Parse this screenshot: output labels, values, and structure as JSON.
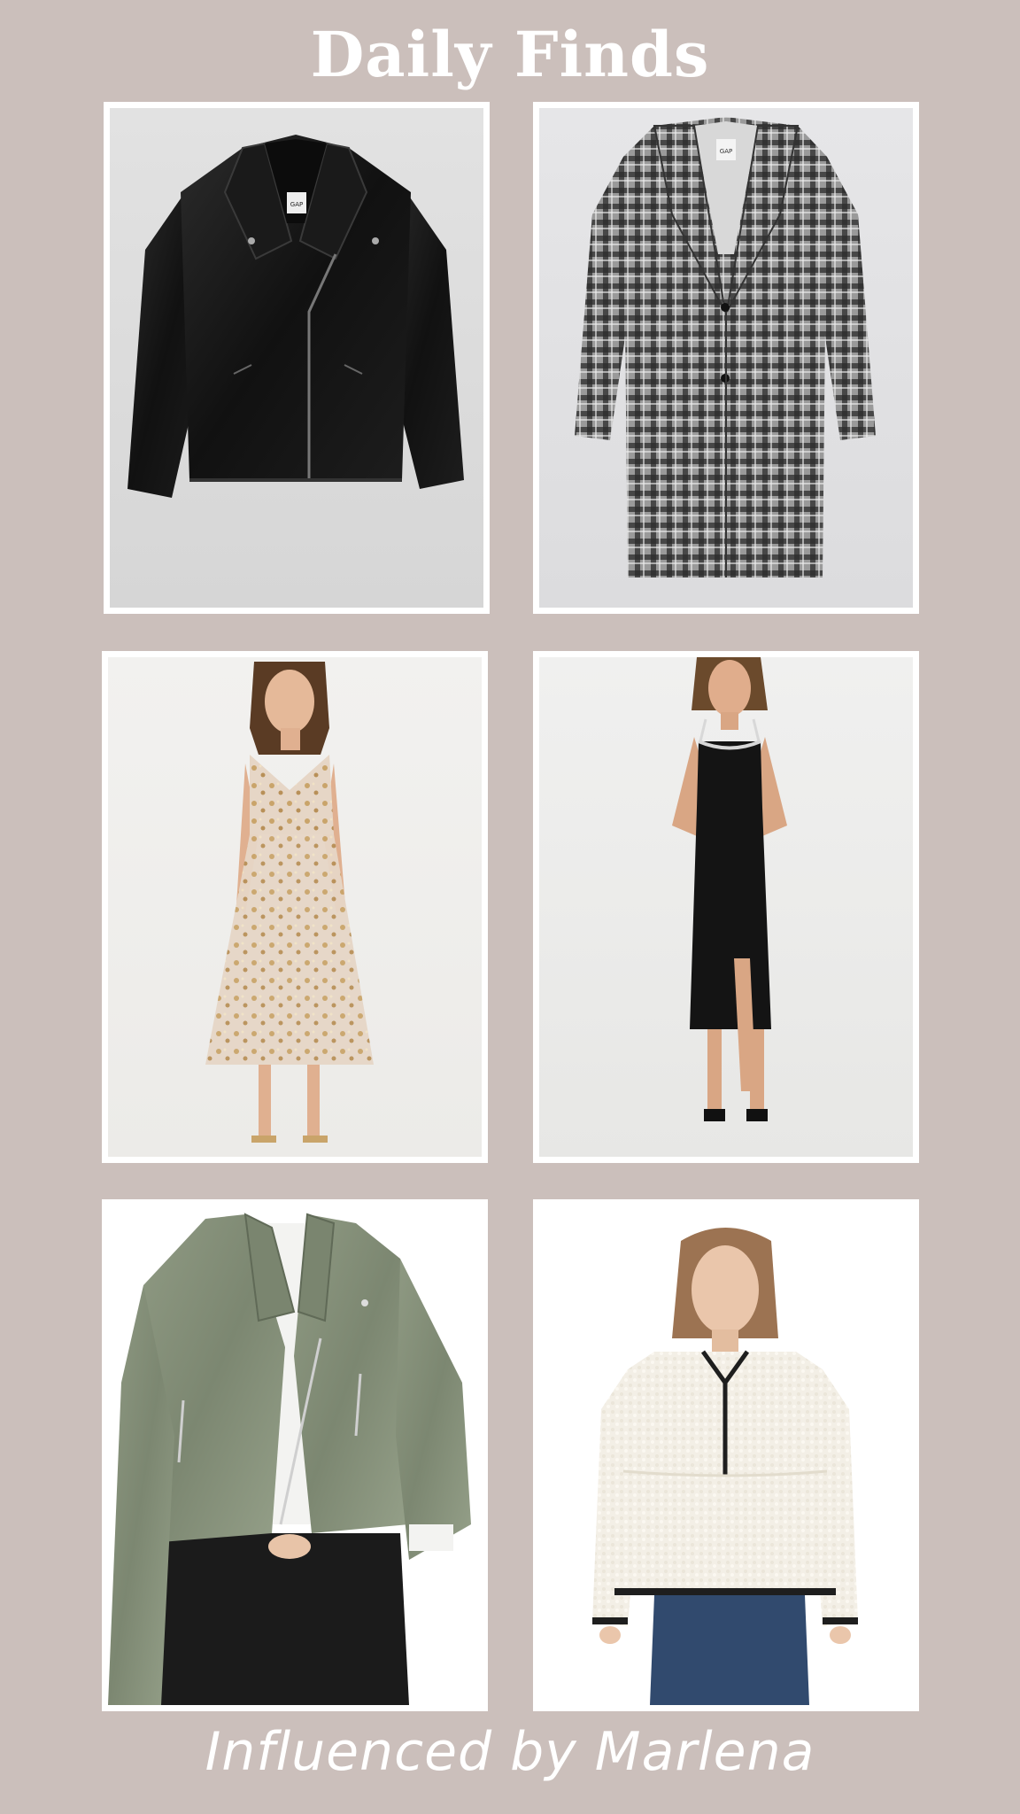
{
  "title": "Daily Finds",
  "footer": "Influenced by Marlena",
  "colors": {
    "background": "#cbbfbb",
    "frame": "#ffffff",
    "text": "#ffffff"
  },
  "items": [
    {
      "depicts": "black-leather-moto-jacket-image",
      "brand_tag": "GAP"
    },
    {
      "depicts": "plaid-long-coat-image",
      "brand_tag": "GAP"
    },
    {
      "depicts": "sequin-floral-midi-dress-image",
      "brand_tag": ""
    },
    {
      "depicts": "black-rhinestone-strap-midi-dress-image",
      "brand_tag": ""
    },
    {
      "depicts": "sage-faux-leather-jacket-image",
      "brand_tag": ""
    },
    {
      "depicts": "cream-sherpa-half-zip-pullover-image",
      "brand_tag": ""
    }
  ]
}
